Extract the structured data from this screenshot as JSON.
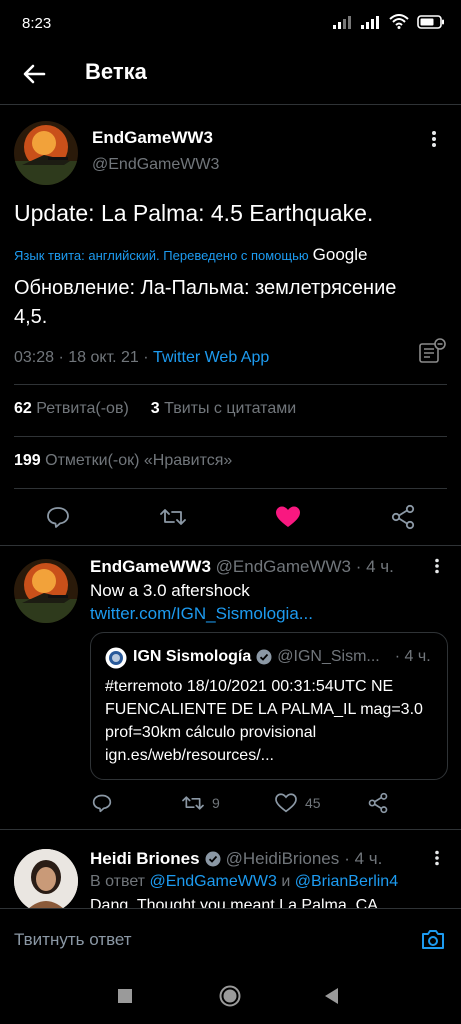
{
  "status": {
    "time": "8:23"
  },
  "header": {
    "title": "Ветка"
  },
  "main_tweet": {
    "display_name": "EndGameWW3",
    "handle": "@EndGameWW3",
    "text": "Update: La Palma: 4.5 Earthquake.",
    "translate_note": "Язык твита: английский. Переведено с помощью",
    "google": "Google",
    "translated_text": "Обновление: Ла-Пальма: землетрясение 4,5.",
    "meta_time": "03:28 · 18 окт. 21 · ",
    "meta_source": "Twitter Web App",
    "retweets_count": "62",
    "retweets_label": "Ретвита(-ов)",
    "quotes_count": "3",
    "quotes_label": "Твиты с цитатами",
    "likes_count": "199",
    "likes_label": "Отметки(-ок) «Нравится»"
  },
  "reply1": {
    "display_name": "EndGameWW3",
    "handle": "@EndGameWW3",
    "time": "· 4 ч.",
    "text": "Now a 3.0 aftershock",
    "link": "twitter.com/IGN_Sismologia...",
    "quote": {
      "display_name": "IGN Sismología",
      "handle": "@IGN_Sism...",
      "time": "· 4 ч.",
      "text": "#terremoto 18/10/2021 00:31:54UTC NE FUENCALIENTE DE LA PALMA_IL mag=3.0 prof=30km cálculo provisional ign.es/web/resources/..."
    },
    "retweets": "9",
    "likes": "45"
  },
  "reply2": {
    "display_name": "Heidi Briones",
    "handle": "@HeidiBriones",
    "time": "· 4 ч.",
    "reply_to_prefix": "В ответ",
    "mention1": "@EndGameWW3",
    "and": "и",
    "mention2": "@BrianBerlin4",
    "text": "Dang. Thought you meant La Palma, CA"
  },
  "reply_box": {
    "placeholder": "Твитнуть ответ"
  },
  "colors": {
    "accent": "#1d9bf0",
    "like": "#f91880",
    "background": "#000000"
  }
}
